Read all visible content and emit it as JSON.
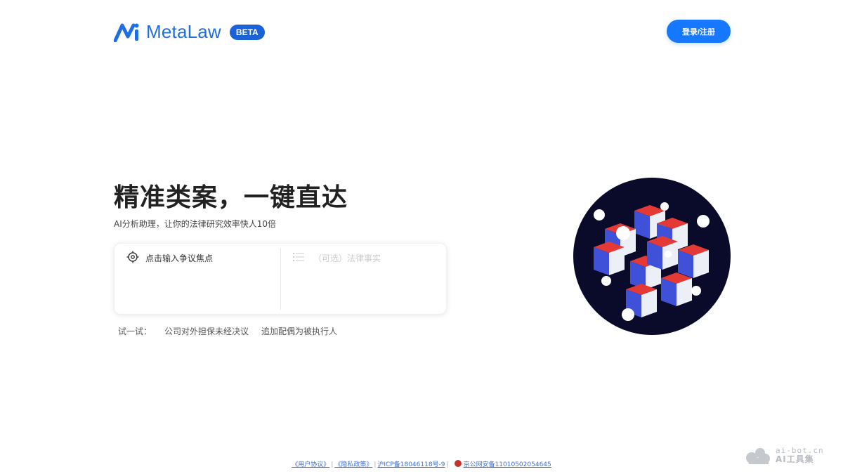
{
  "header": {
    "logo_text": "MetaLaw",
    "beta_badge": "BETA",
    "login_button": "登录/注册"
  },
  "hero": {
    "title": "精准类案，一键直达",
    "subtitle": "AI分析助理，让你的法律研究效率快人10倍"
  },
  "search": {
    "focus_placeholder": "点击输入争议焦点",
    "facts_placeholder": "（可选）法律事实"
  },
  "try": {
    "label": "试一试：",
    "examples": [
      "公司对外担保未经决议",
      "追加配偶为被执行人"
    ]
  },
  "footer": {
    "user_agreement": "《用户协议》",
    "privacy_policy": "《隐私政策》",
    "icp": "沪ICP备18046118号-9",
    "police": "京公网安备11010502054645"
  },
  "watermark": {
    "domain": "ai-bot.cn",
    "name": "AI工具集"
  },
  "colors": {
    "brand_blue": "#1f6fe0",
    "button_blue": "#1677ff",
    "illustration_bg": "#0a0a2a",
    "cube_red": "#e53935",
    "cube_blue": "#3f51d8"
  },
  "icons": {
    "logo": "metalaw-logo-icon",
    "focus": "target-icon",
    "facts": "list-icon",
    "submit": "arrow-right-icon",
    "police": "police-badge-icon"
  }
}
